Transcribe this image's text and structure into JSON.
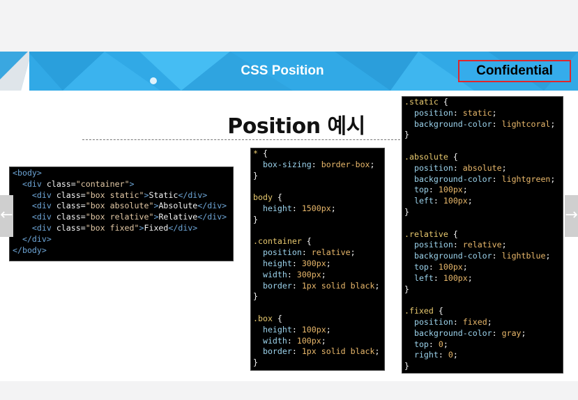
{
  "slide": {
    "banner_title": "CSS Position",
    "confidential_label": "Confidential",
    "heading": "Position 예시"
  },
  "navigation": {
    "prev_icon": "arrow-left-icon",
    "next_icon": "arrow-right-icon",
    "prev_glyph": "←",
    "next_glyph": "→"
  },
  "html_code": [
    [
      [
        "tag",
        "<body>"
      ]
    ],
    [
      [
        "tag",
        "  <div "
      ],
      [
        "attr",
        "class="
      ],
      [
        "str",
        "\"container\""
      ],
      [
        "tag",
        ">"
      ]
    ],
    [
      [
        "tag",
        "    <div "
      ],
      [
        "attr",
        "class="
      ],
      [
        "str",
        "\"box static\""
      ],
      [
        "tag",
        ">"
      ],
      [
        "attr",
        "Static"
      ],
      [
        "tag",
        "</div>"
      ]
    ],
    [
      [
        "tag",
        "    <div "
      ],
      [
        "attr",
        "class="
      ],
      [
        "str",
        "\"box absolute\""
      ],
      [
        "tag",
        ">"
      ],
      [
        "attr",
        "Absolute"
      ],
      [
        "tag",
        "</div>"
      ]
    ],
    [
      [
        "tag",
        "    <div "
      ],
      [
        "attr",
        "class="
      ],
      [
        "str",
        "\"box relative\""
      ],
      [
        "tag",
        ">"
      ],
      [
        "attr",
        "Relative"
      ],
      [
        "tag",
        "</div>"
      ]
    ],
    [
      [
        "tag",
        "    <div "
      ],
      [
        "attr",
        "class="
      ],
      [
        "str",
        "\"box fixed\""
      ],
      [
        "tag",
        ">"
      ],
      [
        "attr",
        "Fixed"
      ],
      [
        "tag",
        "</div>"
      ]
    ],
    [
      [
        "tag",
        "  </div>"
      ]
    ],
    [
      [
        "tag",
        "</body>"
      ]
    ]
  ],
  "css_code_1": [
    [
      [
        "sel",
        "* "
      ],
      [
        "attr",
        "{"
      ]
    ],
    [
      [
        "prop",
        "  box-sizing"
      ],
      [
        "attr",
        ": "
      ],
      [
        "val",
        "border-box"
      ],
      [
        "attr",
        ";"
      ]
    ],
    [
      [
        "attr",
        "}"
      ]
    ],
    [
      [
        "attr",
        ""
      ]
    ],
    [
      [
        "sel",
        "body "
      ],
      [
        "attr",
        "{"
      ]
    ],
    [
      [
        "prop",
        "  height"
      ],
      [
        "attr",
        ": "
      ],
      [
        "val",
        "1500px"
      ],
      [
        "attr",
        ";"
      ]
    ],
    [
      [
        "attr",
        "}"
      ]
    ],
    [
      [
        "attr",
        ""
      ]
    ],
    [
      [
        "sel",
        ".container "
      ],
      [
        "attr",
        "{"
      ]
    ],
    [
      [
        "prop",
        "  position"
      ],
      [
        "attr",
        ": "
      ],
      [
        "val",
        "relative"
      ],
      [
        "attr",
        ";"
      ]
    ],
    [
      [
        "prop",
        "  height"
      ],
      [
        "attr",
        ": "
      ],
      [
        "val",
        "300px"
      ],
      [
        "attr",
        ";"
      ]
    ],
    [
      [
        "prop",
        "  width"
      ],
      [
        "attr",
        ": "
      ],
      [
        "val",
        "300px"
      ],
      [
        "attr",
        ";"
      ]
    ],
    [
      [
        "prop",
        "  border"
      ],
      [
        "attr",
        ": "
      ],
      [
        "val",
        "1px solid black"
      ],
      [
        "attr",
        ";"
      ]
    ],
    [
      [
        "attr",
        "}"
      ]
    ],
    [
      [
        "attr",
        ""
      ]
    ],
    [
      [
        "sel",
        ".box "
      ],
      [
        "attr",
        "{"
      ]
    ],
    [
      [
        "prop",
        "  height"
      ],
      [
        "attr",
        ": "
      ],
      [
        "val",
        "100px"
      ],
      [
        "attr",
        ";"
      ]
    ],
    [
      [
        "prop",
        "  width"
      ],
      [
        "attr",
        ": "
      ],
      [
        "val",
        "100px"
      ],
      [
        "attr",
        ";"
      ]
    ],
    [
      [
        "prop",
        "  border"
      ],
      [
        "attr",
        ": "
      ],
      [
        "val",
        "1px solid black"
      ],
      [
        "attr",
        ";"
      ]
    ],
    [
      [
        "attr",
        "}"
      ]
    ]
  ],
  "css_code_2": [
    [
      [
        "sel",
        ".static "
      ],
      [
        "attr",
        "{"
      ]
    ],
    [
      [
        "prop",
        "  position"
      ],
      [
        "attr",
        ": "
      ],
      [
        "val",
        "static"
      ],
      [
        "attr",
        ";"
      ]
    ],
    [
      [
        "prop",
        "  background-color"
      ],
      [
        "attr",
        ": "
      ],
      [
        "val",
        "lightcoral"
      ],
      [
        "attr",
        ";"
      ]
    ],
    [
      [
        "attr",
        "}"
      ]
    ],
    [
      [
        "attr",
        ""
      ]
    ],
    [
      [
        "sel",
        ".absolute "
      ],
      [
        "attr",
        "{"
      ]
    ],
    [
      [
        "prop",
        "  position"
      ],
      [
        "attr",
        ": "
      ],
      [
        "val",
        "absolute"
      ],
      [
        "attr",
        ";"
      ]
    ],
    [
      [
        "prop",
        "  background-color"
      ],
      [
        "attr",
        ": "
      ],
      [
        "val",
        "lightgreen"
      ],
      [
        "attr",
        ";"
      ]
    ],
    [
      [
        "prop",
        "  top"
      ],
      [
        "attr",
        ": "
      ],
      [
        "val",
        "100px"
      ],
      [
        "attr",
        ";"
      ]
    ],
    [
      [
        "prop",
        "  left"
      ],
      [
        "attr",
        ": "
      ],
      [
        "val",
        "100px"
      ],
      [
        "attr",
        ";"
      ]
    ],
    [
      [
        "attr",
        "}"
      ]
    ],
    [
      [
        "attr",
        ""
      ]
    ],
    [
      [
        "sel",
        ".relative "
      ],
      [
        "attr",
        "{"
      ]
    ],
    [
      [
        "prop",
        "  position"
      ],
      [
        "attr",
        ": "
      ],
      [
        "val",
        "relative"
      ],
      [
        "attr",
        ";"
      ]
    ],
    [
      [
        "prop",
        "  background-color"
      ],
      [
        "attr",
        ": "
      ],
      [
        "val",
        "lightblue"
      ],
      [
        "attr",
        ";"
      ]
    ],
    [
      [
        "prop",
        "  top"
      ],
      [
        "attr",
        ": "
      ],
      [
        "val",
        "100px"
      ],
      [
        "attr",
        ";"
      ]
    ],
    [
      [
        "prop",
        "  left"
      ],
      [
        "attr",
        ": "
      ],
      [
        "val",
        "100px"
      ],
      [
        "attr",
        ";"
      ]
    ],
    [
      [
        "attr",
        "}"
      ]
    ],
    [
      [
        "attr",
        ""
      ]
    ],
    [
      [
        "sel",
        ".fixed "
      ],
      [
        "attr",
        "{"
      ]
    ],
    [
      [
        "prop",
        "  position"
      ],
      [
        "attr",
        ": "
      ],
      [
        "val",
        "fixed"
      ],
      [
        "attr",
        ";"
      ]
    ],
    [
      [
        "prop",
        "  background-color"
      ],
      [
        "attr",
        ": "
      ],
      [
        "val",
        "gray"
      ],
      [
        "attr",
        ";"
      ]
    ],
    [
      [
        "prop",
        "  top"
      ],
      [
        "attr",
        ": "
      ],
      [
        "val",
        "0"
      ],
      [
        "attr",
        ";"
      ]
    ],
    [
      [
        "prop",
        "  right"
      ],
      [
        "attr",
        ": "
      ],
      [
        "val",
        "0"
      ],
      [
        "attr",
        ";"
      ]
    ],
    [
      [
        "attr",
        "}"
      ]
    ]
  ],
  "colors": {
    "banner": "#31a9e6",
    "confidential_border": "#e0262b",
    "code_background": "#000000"
  }
}
